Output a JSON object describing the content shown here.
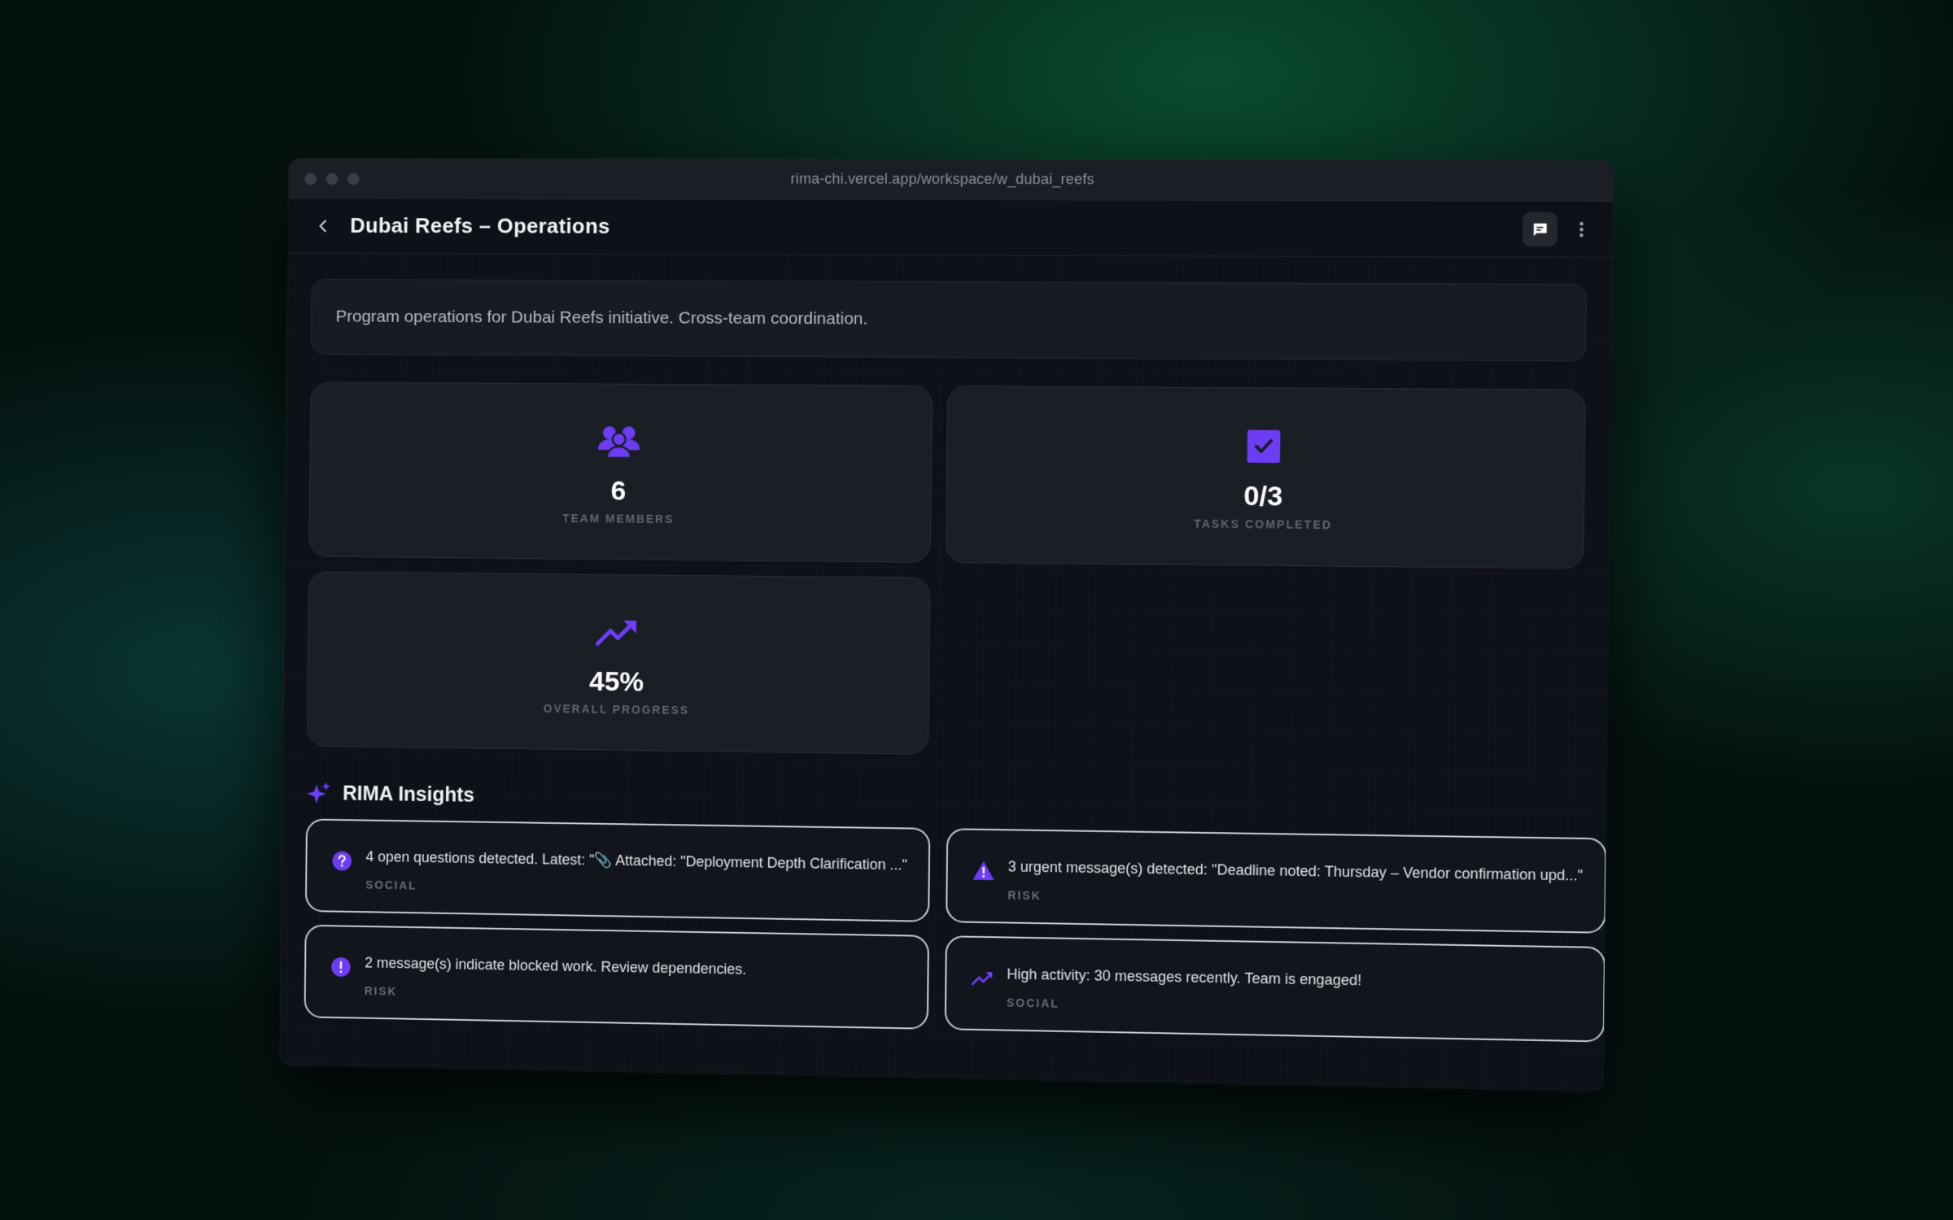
{
  "browser": {
    "url": "rima-chi.vercel.app/workspace/w_dubai_reefs"
  },
  "header": {
    "title": "Dubai Reefs – Operations"
  },
  "description": "Program operations for Dubai Reefs initiative. Cross-team coordination.",
  "stats": [
    {
      "icon": "team-icon",
      "value": "6",
      "label": "TEAM MEMBERS"
    },
    {
      "icon": "checkbox-icon",
      "value": "0/3",
      "label": "TASKS COMPLETED"
    },
    {
      "icon": "trending-up-icon",
      "value": "45%",
      "label": "OVERALL PROGRESS"
    }
  ],
  "insights": {
    "title": "RIMA Insights",
    "items": [
      {
        "icon": "question-icon",
        "text": "4 open questions detected. Latest: \"📎 Attached: \"Deployment Depth Clarification ...\"",
        "tag": "SOCIAL"
      },
      {
        "icon": "warning-icon",
        "text": "3 urgent message(s) detected: \"Deadline noted: Thursday – Vendor confirmation upd...\"",
        "tag": "RISK"
      },
      {
        "icon": "alert-icon",
        "text": "2 message(s) indicate blocked work. Review dependencies.",
        "tag": "RISK"
      },
      {
        "icon": "trending-up-icon",
        "text": "High activity: 30 messages recently. Team is engaged!",
        "tag": "SOCIAL"
      }
    ]
  },
  "colors": {
    "accent": "#6d3df5",
    "background": "#0e1117",
    "card": "#1a1e25"
  }
}
